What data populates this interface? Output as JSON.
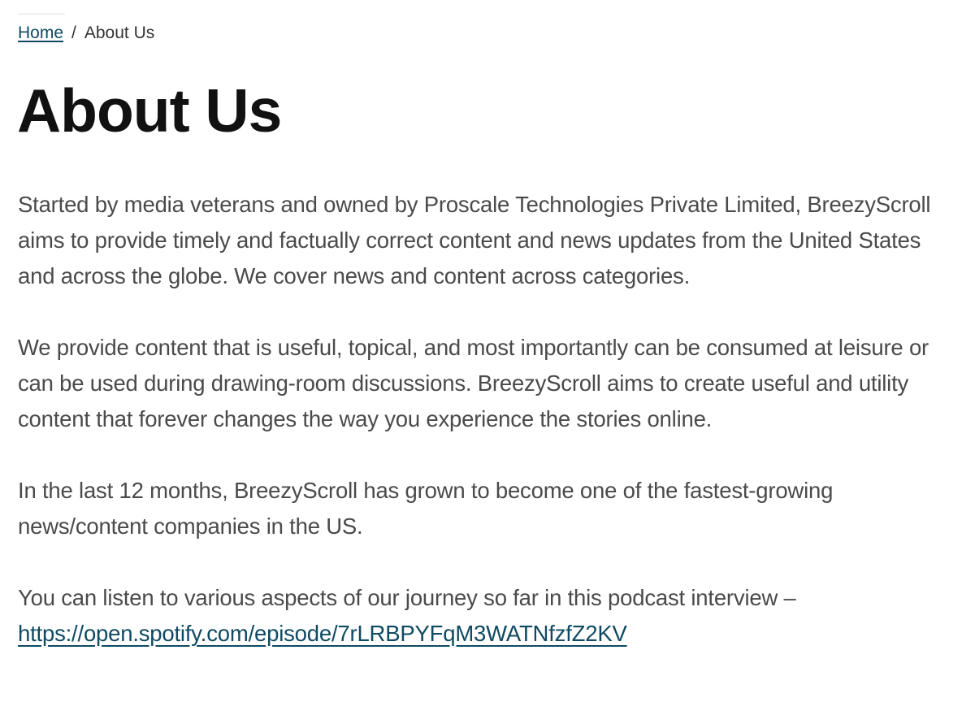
{
  "breadcrumb": {
    "home_label": "Home",
    "separator": "/",
    "current_label": "About Us"
  },
  "page": {
    "title": "About Us"
  },
  "content": {
    "paragraph_1": "Started by media veterans and owned by Proscale Technologies Private Limited, BreezyScroll aims to provide timely and factually correct content and news updates from the United States and across the globe. We cover news and content across categories.",
    "paragraph_2": "We provide content that is useful, topical, and most importantly can be consumed at leisure or can be used during drawing-room discussions. BreezyScroll aims to create useful and utility content that forever changes the way you experience the stories online.",
    "paragraph_3": "In the last 12 months, BreezyScroll has grown to become one of the fastest-growing news/content companies in the US.",
    "paragraph_4_text": "You can listen to various aspects of our journey so far in this podcast interview –",
    "podcast_link_text": "https://open.spotify.com/episode/7rLRBPYFqM3WATNfzfZ2KV"
  },
  "colors": {
    "link": "#0f4a63",
    "title": "#111111",
    "body_text": "#4a4a4a"
  }
}
